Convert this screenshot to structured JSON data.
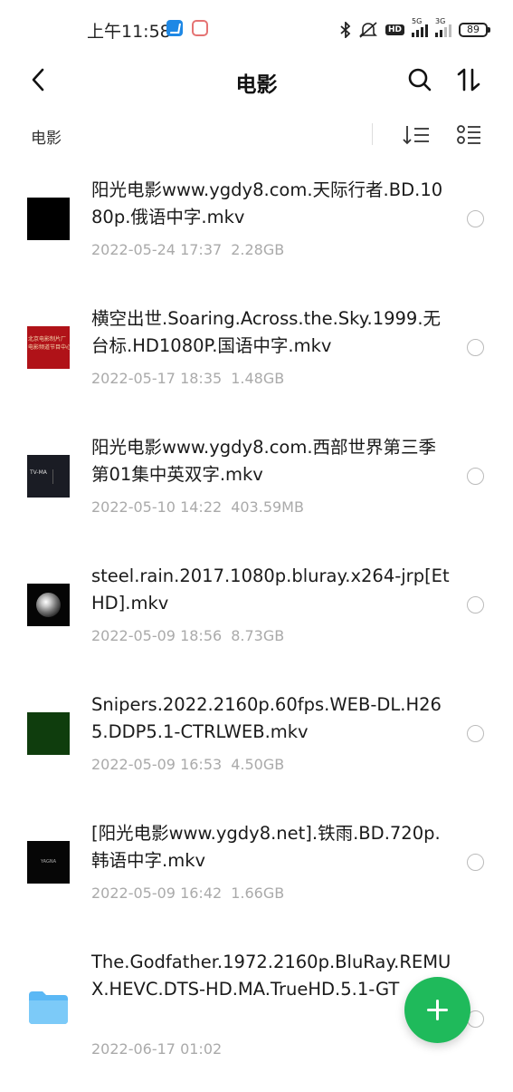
{
  "status_bar": {
    "time": "上午11:58",
    "network_1": "5G",
    "network_2": "3G",
    "hd_label": "HD",
    "battery": "89"
  },
  "header": {
    "title": "电影"
  },
  "toolbar": {
    "breadcrumb": "电影"
  },
  "files": [
    {
      "name": "阳光电影www.ygdy8.com.天际行者.BD.1080p.俄语中字.mkv",
      "date": "2022-05-24 17:37",
      "size": "2.28GB"
    },
    {
      "name": "横空出世.Soaring.Across.the.Sky.1999.无台标.HD1080P.国语中字.mkv",
      "date": "2022-05-17 18:35",
      "size": "1.48GB",
      "thumb_text_1": "北京电影制片厂",
      "thumb_text_2": "电影频道节目中心"
    },
    {
      "name": "阳光电影www.ygdy8.com.西部世界第三季第01集中英双字.mkv",
      "date": "2022-05-10 14:22",
      "size": "403.59MB",
      "thumb_text_1": "TV-MA"
    },
    {
      "name": "steel.rain.2017.1080p.bluray.x264-jrp[EtHD].mkv",
      "date": "2022-05-09 18:56",
      "size": "8.73GB"
    },
    {
      "name": "Snipers.2022.2160p.60fps.WEB-DL.H265.DDP5.1-CTRLWEB.mkv",
      "date": "2022-05-09 16:53",
      "size": "4.50GB"
    },
    {
      "name": "[阳光电影www.ygdy8.net].铁雨.BD.720p.韩语中字.mkv",
      "date": "2022-05-09 16:42",
      "size": "1.66GB",
      "thumb_text_1": "YAGNA"
    },
    {
      "name": "The.Godfather.1972.2160p.BluRay.REMUX.HEVC.DTS-HD.MA.TrueHD.5.1-GT",
      "date": "2022-06-17 01:02",
      "size": ""
    }
  ],
  "colors": {
    "accent": "#1fba5b",
    "folder": "#5bb8f5"
  }
}
